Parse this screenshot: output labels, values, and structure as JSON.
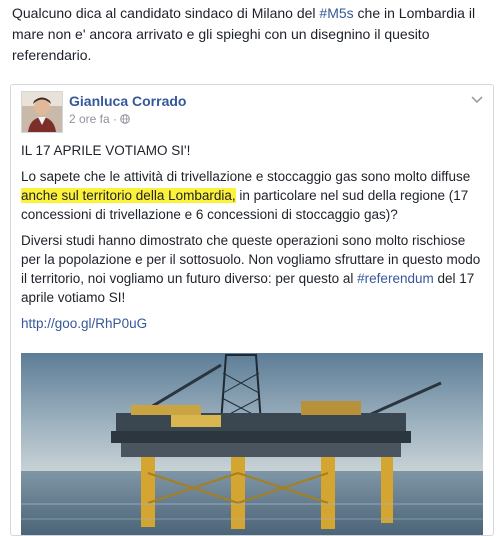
{
  "intro": {
    "part1": "Qualcuno dica al candidato sindaco di Milano del ",
    "hashtag": "#M5s",
    "part2": " che in Lombardia il mare non e' ancora arrivato e gli spieghi con un disegnino il quesito referendario."
  },
  "card": {
    "author": "Gianluca Corrado",
    "time": "2 ore fa",
    "separator": " · ",
    "privacy_icon": "globe-icon",
    "menu_icon": "chevron-down-icon",
    "title": "IL 17 APRILE VOTIAMO SI'!",
    "p1": {
      "before": "Lo sapete che le attività di trivellazione e stoccaggio gas sono molto diffuse ",
      "highlight": "anche sul territorio della Lombardia,",
      "after": " in particolare nel sud della regione (17 concessioni di trivellazione e 6 concessioni di stoccaggio gas)?"
    },
    "p2": {
      "before": "Diversi studi hanno dimostrato che queste operazioni sono molto rischiose per la popolazione e per il sottosuolo. Non vogliamo sfruttare in questo modo il territorio, noi vogliamo un futuro diverso: per questo al ",
      "hashtag": "#referendum",
      "after": " del 17 aprile votiamo SI!"
    },
    "url": "http://goo.gl/RhP0uG",
    "highlight_color": "#fdf23a",
    "link_color": "#365899"
  }
}
